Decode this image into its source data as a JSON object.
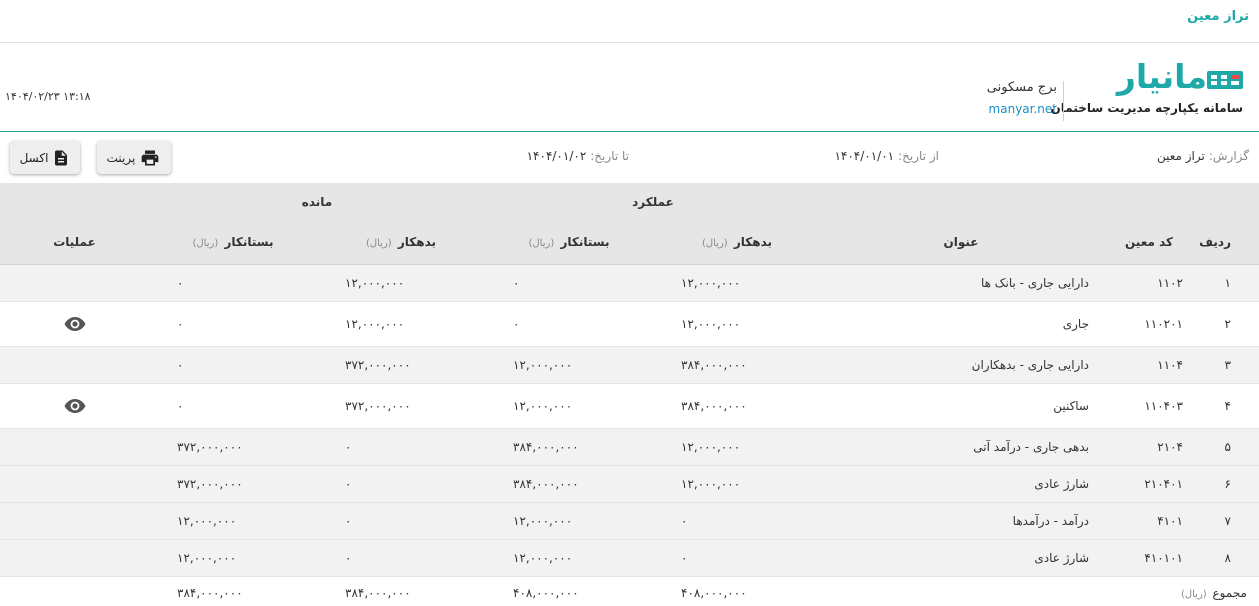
{
  "page_title": "تراز معین",
  "brand": {
    "name": "مانیار",
    "tagline": "سامانه یکپارچه مدیریت ساختمان",
    "building": "برج مسکونی",
    "site": "manyar.net"
  },
  "datetime": "۱۴۰۴/۰۲/۲۳ ۱۳:۱۸",
  "filters": {
    "report_label": "گزارش:",
    "report_value": "تراز معین",
    "from_label": "از تاریخ:",
    "from_value": "۱۴۰۴/۰۱/۰۱",
    "to_label": "تا تاریخ:",
    "to_value": "۱۴۰۴/۰۱/۰۲"
  },
  "toolbar": {
    "print_label": "پرینت",
    "excel_label": "اکسل"
  },
  "table": {
    "group_performance": "عملکرد",
    "group_balance": "مانده",
    "col_idx": "ردیف",
    "col_code": "کد معین",
    "col_title": "عنوان",
    "col_debit": "بدهکار",
    "col_credit": "بستانکار",
    "col_actions": "عملیات",
    "unit": "(ریال)",
    "rows": [
      {
        "idx": "۱",
        "code": "۱۱۰۲",
        "title": "دارایی جاری - بانک ها",
        "perf_debit": "۱۲,۰۰۰,۰۰۰",
        "perf_credit": "۰",
        "bal_debit": "۱۲,۰۰۰,۰۰۰",
        "bal_credit": "۰",
        "action": ""
      },
      {
        "idx": "۲",
        "code": "۱۱۰۲۰۱",
        "title": "جاری",
        "perf_debit": "۱۲,۰۰۰,۰۰۰",
        "perf_credit": "۰",
        "bal_debit": "۱۲,۰۰۰,۰۰۰",
        "bal_credit": "۰",
        "action": "eye-icon"
      },
      {
        "idx": "۳",
        "code": "۱۱۰۴",
        "title": "دارایی جاری - بدهکاران",
        "perf_debit": "۳۸۴,۰۰۰,۰۰۰",
        "perf_credit": "۱۲,۰۰۰,۰۰۰",
        "bal_debit": "۳۷۲,۰۰۰,۰۰۰",
        "bal_credit": "۰",
        "action": ""
      },
      {
        "idx": "۴",
        "code": "۱۱۰۴۰۳",
        "title": "ساکنین",
        "perf_debit": "۳۸۴,۰۰۰,۰۰۰",
        "perf_credit": "۱۲,۰۰۰,۰۰۰",
        "bal_debit": "۳۷۲,۰۰۰,۰۰۰",
        "bal_credit": "۰",
        "action": "eye-icon"
      },
      {
        "idx": "۵",
        "code": "۲۱۰۴",
        "title": "بدهی جاری - درآمد آتی",
        "perf_debit": "۱۲,۰۰۰,۰۰۰",
        "perf_credit": "۳۸۴,۰۰۰,۰۰۰",
        "bal_debit": "۰",
        "bal_credit": "۳۷۲,۰۰۰,۰۰۰",
        "action": ""
      },
      {
        "idx": "۶",
        "code": "۲۱۰۴۰۱",
        "title": "شارژ عادی",
        "perf_debit": "۱۲,۰۰۰,۰۰۰",
        "perf_credit": "۳۸۴,۰۰۰,۰۰۰",
        "bal_debit": "۰",
        "bal_credit": "۳۷۲,۰۰۰,۰۰۰",
        "action": ""
      },
      {
        "idx": "۷",
        "code": "۴۱۰۱",
        "title": "درآمد - درآمدها",
        "perf_debit": "۰",
        "perf_credit": "۱۲,۰۰۰,۰۰۰",
        "bal_debit": "۰",
        "bal_credit": "۱۲,۰۰۰,۰۰۰",
        "action": ""
      },
      {
        "idx": "۸",
        "code": "۴۱۰۱۰۱",
        "title": "شارژ عادی",
        "perf_debit": "۰",
        "perf_credit": "۱۲,۰۰۰,۰۰۰",
        "bal_debit": "۰",
        "bal_credit": "۱۲,۰۰۰,۰۰۰",
        "action": ""
      }
    ],
    "total": {
      "label": "مجموع",
      "perf_debit": "۴۰۸,۰۰۰,۰۰۰",
      "perf_credit": "۴۰۸,۰۰۰,۰۰۰",
      "bal_debit": "۳۸۴,۰۰۰,۰۰۰",
      "bal_credit": "۳۸۴,۰۰۰,۰۰۰"
    }
  },
  "colors": {
    "accent": "#1fa8a8",
    "link": "#1a8fc4",
    "header_bg": "#e6e6e6",
    "row_alt": "#f2f2f2"
  }
}
